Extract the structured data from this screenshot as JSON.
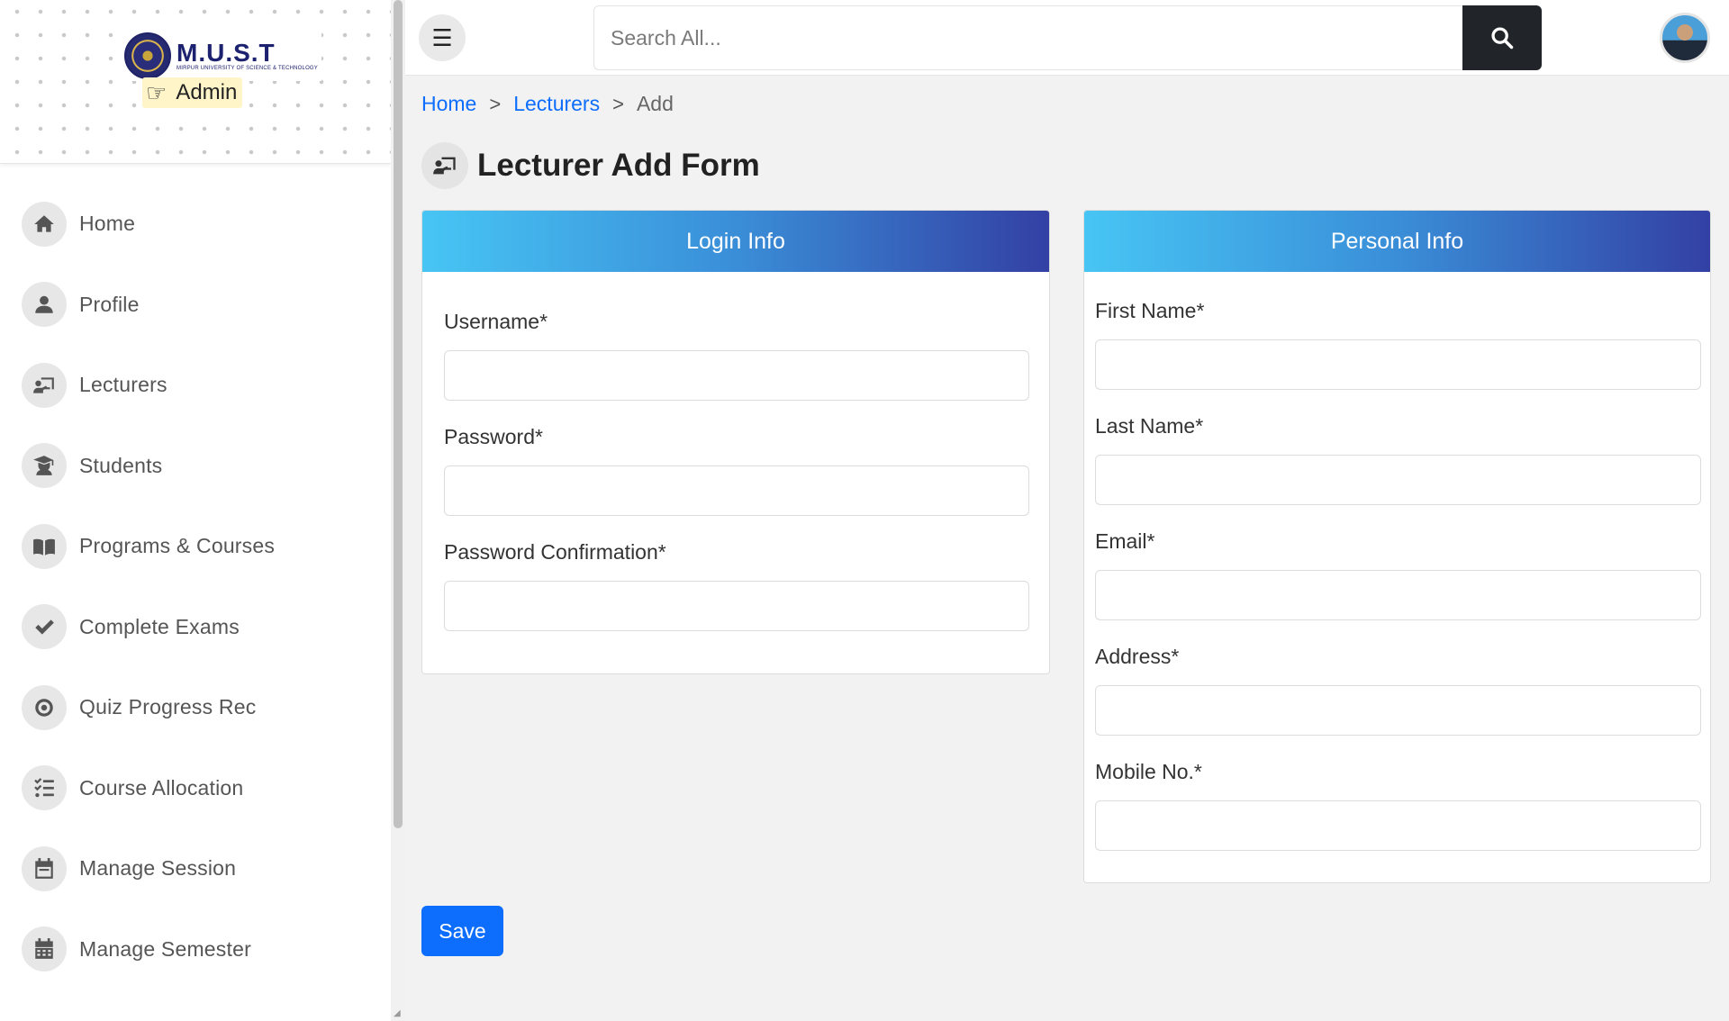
{
  "brand": {
    "name": "M.U.S.T",
    "subtitle": "MIRPUR UNIVERSITY OF SCIENCE & TECHNOLOGY",
    "role": "Admin",
    "role_icon": "pointing-hand-icon"
  },
  "sidebar": {
    "items": [
      {
        "label": "Home",
        "icon": "home-icon"
      },
      {
        "label": "Profile",
        "icon": "user-icon"
      },
      {
        "label": "Lecturers",
        "icon": "chalkboard-teacher-icon"
      },
      {
        "label": "Students",
        "icon": "graduate-icon"
      },
      {
        "label": "Programs & Courses",
        "icon": "book-icon"
      },
      {
        "label": "Complete Exams",
        "icon": "check-double-icon"
      },
      {
        "label": "Quiz Progress Rec",
        "icon": "record-icon"
      },
      {
        "label": "Course Allocation",
        "icon": "tasks-list-icon"
      },
      {
        "label": "Manage Session",
        "icon": "calendar-icon"
      },
      {
        "label": "Manage Semester",
        "icon": "calendar-grid-icon"
      }
    ]
  },
  "topbar": {
    "search_placeholder": "Search All..."
  },
  "breadcrumb": {
    "home": "Home",
    "lecturers": "Lecturers",
    "current": "Add",
    "separator": ">"
  },
  "page": {
    "title": "Lecturer Add Form"
  },
  "login_card": {
    "header": "Login Info",
    "fields": [
      {
        "label": "Username*",
        "value": ""
      },
      {
        "label": "Password*",
        "value": ""
      },
      {
        "label": "Password Confirmation*",
        "value": ""
      }
    ]
  },
  "personal_card": {
    "header": "Personal Info",
    "fields": [
      {
        "label": "First Name*",
        "value": ""
      },
      {
        "label": "Last Name*",
        "value": ""
      },
      {
        "label": "Email*",
        "value": ""
      },
      {
        "label": "Address*",
        "value": ""
      },
      {
        "label": "Mobile No.*",
        "value": ""
      }
    ]
  },
  "actions": {
    "save_label": "Save"
  },
  "colors": {
    "primary": "#0d6efd",
    "header_gradient_start": "#47c5f4",
    "header_gradient_end": "#3340a4",
    "search_button": "#212529"
  }
}
